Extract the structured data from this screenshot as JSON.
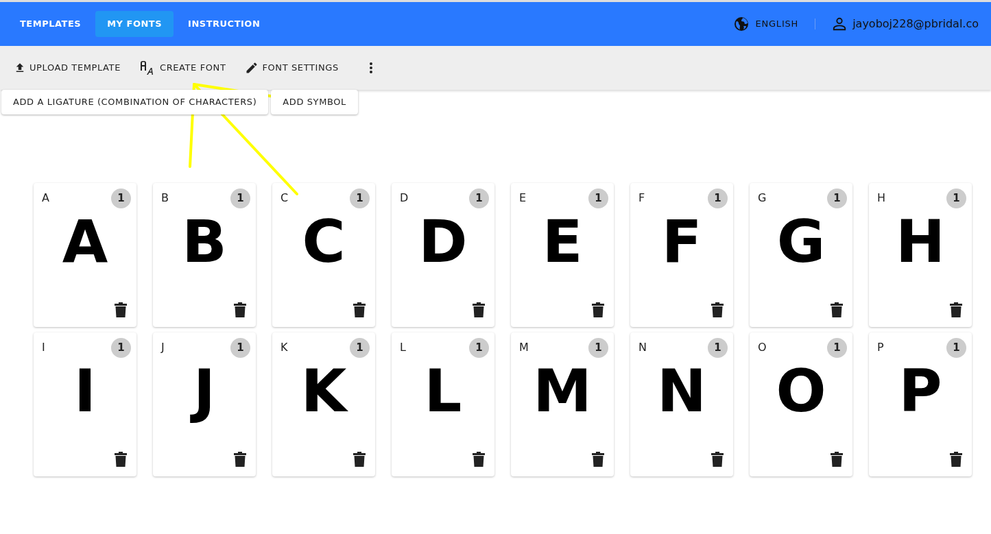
{
  "nav": {
    "tabs": [
      {
        "label": "TEMPLATES",
        "selected": false
      },
      {
        "label": "MY FONTS",
        "selected": true
      },
      {
        "label": "INSTRUCTION",
        "selected": false
      }
    ],
    "language": "ENGLISH",
    "user": "jayoboj228@pbridal.co"
  },
  "toolbar": [
    {
      "label": "UPLOAD TEMPLATE",
      "kind": "upload"
    },
    {
      "label": "CREATE FONT",
      "kind": "font"
    },
    {
      "label": "FONT SETTINGS",
      "kind": "edit"
    },
    {
      "kind": "more"
    }
  ],
  "actions": [
    "ADD A LIGATURE (COMBINATION OF CHARACTERS)",
    "ADD SYMBOL"
  ],
  "glyphs": [
    {
      "label": "A",
      "glyph": "A",
      "count": "1"
    },
    {
      "label": "B",
      "glyph": "B",
      "count": "1"
    },
    {
      "label": "C",
      "glyph": "C",
      "count": "1"
    },
    {
      "label": "D",
      "glyph": "D",
      "count": "1"
    },
    {
      "label": "E",
      "glyph": "E",
      "count": "1"
    },
    {
      "label": "F",
      "glyph": "F",
      "count": "1"
    },
    {
      "label": "G",
      "glyph": "G",
      "count": "1"
    },
    {
      "label": "H",
      "glyph": "H",
      "count": "1"
    },
    {
      "label": "I",
      "glyph": "I",
      "count": "1"
    },
    {
      "label": "J",
      "glyph": "J",
      "count": "1"
    },
    {
      "label": "K",
      "glyph": "K",
      "count": "1"
    },
    {
      "label": "L",
      "glyph": "L",
      "count": "1"
    },
    {
      "label": "M",
      "glyph": "M",
      "count": "1"
    },
    {
      "label": "N",
      "glyph": "N",
      "count": "1"
    },
    {
      "label": "O",
      "glyph": "O",
      "count": "1"
    },
    {
      "label": "P",
      "glyph": "P",
      "count": "1"
    }
  ]
}
